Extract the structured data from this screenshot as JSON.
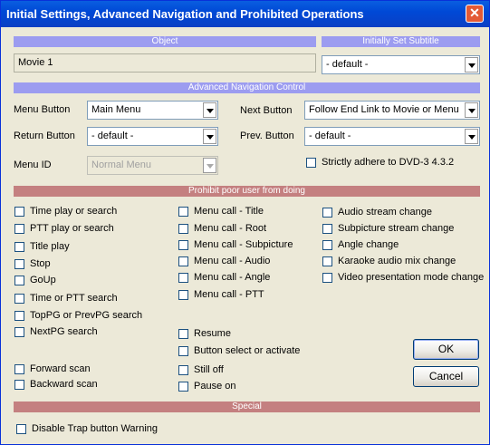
{
  "window": {
    "title": "Initial Settings, Advanced Navigation and Prohibited Operations",
    "close_glyph": "✕"
  },
  "headers": {
    "object": "Object",
    "subtitle": "Initially Set Subtitle",
    "advanced": "Advanced Navigation Control",
    "prohibit": "Prohibit poor user from doing",
    "special": "Special"
  },
  "object": {
    "value": "Movie 1"
  },
  "subtitle": {
    "value": "- default -"
  },
  "nav": {
    "menu_button_label": "Menu Button",
    "menu_button_value": "Main Menu",
    "return_button_label": "Return Button",
    "return_button_value": "- default -",
    "menu_id_label": "Menu ID",
    "menu_id_value": "Normal Menu",
    "next_button_label": "Next Button",
    "next_button_value": "Follow End Link to Movie or Menu",
    "prev_button_label": "Prev. Button",
    "prev_button_value": "- default -",
    "strict_label": "Strictly adhere to DVD-3 4.3.2"
  },
  "prohibit": {
    "col1": [
      "Time play or search",
      "PTT play or search",
      "Title play",
      "Stop",
      "GoUp",
      "Time or PTT search",
      "TopPG or PrevPG search",
      "NextPG search",
      "Forward scan",
      "Backward scan"
    ],
    "col2": [
      "Menu call - Title",
      "Menu call - Root",
      "Menu call - Subpicture",
      "Menu call - Audio",
      "Menu call - Angle",
      "Menu call - PTT",
      "Resume",
      "Button select or activate",
      "Still off",
      "Pause on"
    ],
    "col3": [
      "Audio stream change",
      "Subpicture stream change",
      "Angle change",
      "Karaoke audio mix change",
      "Video presentation mode change"
    ]
  },
  "special": {
    "disable_trap": "Disable Trap button Warning"
  },
  "buttons": {
    "ok": "OK",
    "cancel": "Cancel"
  }
}
